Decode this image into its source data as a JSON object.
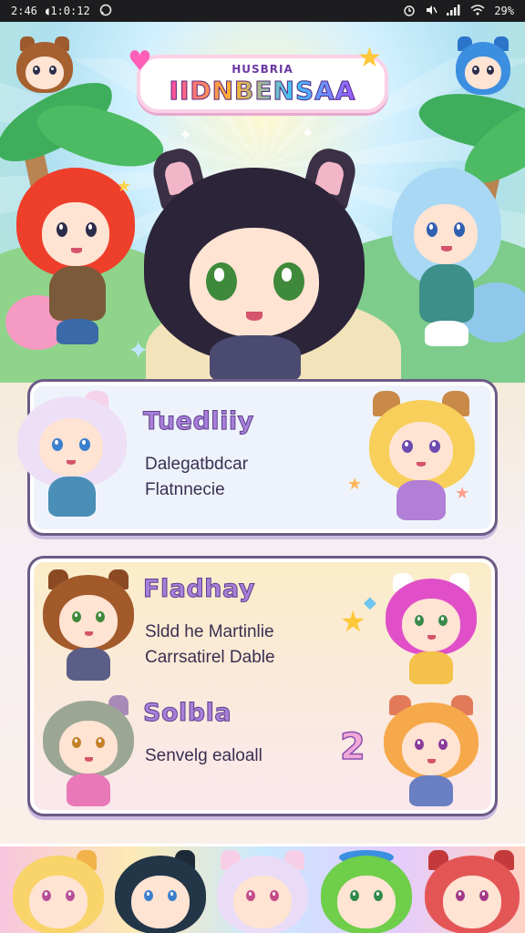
{
  "status_bar": {
    "time": "2:46 ◖1:0:12",
    "battery": "29%",
    "icons": [
      "whatsapp-icon",
      "alarm-icon",
      "mute-icon",
      "signal-icon",
      "wifi-icon",
      "battery-icon"
    ]
  },
  "logo": {
    "small_text": "HUSBRIA",
    "main_text": "IIDNBENSAA"
  },
  "cards": [
    {
      "entries": [
        {
          "title": "Tuedliiy",
          "lines": [
            "Dalegatbdcar",
            "Flatnnecie"
          ]
        }
      ]
    },
    {
      "entries": [
        {
          "title": "Fladhay",
          "lines": [
            "Sldd he Martinlie",
            "Carrsatirel Dable"
          ]
        },
        {
          "title": "Solbla",
          "lines": [
            "Senvelg ealoall"
          ]
        }
      ]
    }
  ],
  "badge_number": "2",
  "colors": {
    "title_purple": "#a77fd8",
    "card_border": "#6b5b86"
  }
}
